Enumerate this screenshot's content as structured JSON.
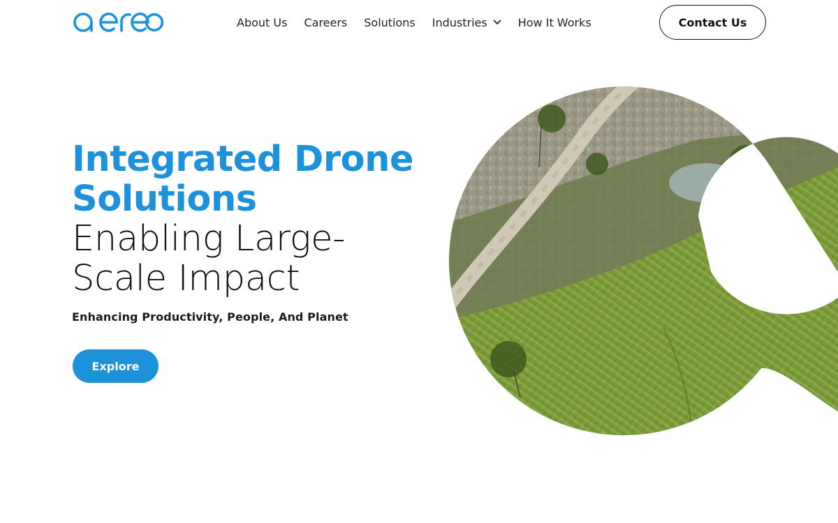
{
  "header": {
    "logo_text": "aereo",
    "nav": [
      {
        "label": "About Us"
      },
      {
        "label": "Careers"
      },
      {
        "label": "Solutions"
      },
      {
        "label": "Industries",
        "has_dropdown": true
      },
      {
        "label": "How It Works"
      }
    ],
    "contact_label": "Contact Us"
  },
  "hero": {
    "title_line1": "Integrated Drone",
    "title_line2": "Solutions",
    "title_line3": "Enabling Large-",
    "title_line4": "Scale Impact",
    "subtitle": "Enhancing Productivity, People, And Planet",
    "cta_label": "Explore",
    "image_icon": "aerial-farmland-letter-a-graphic"
  },
  "colors": {
    "brand_blue": "#1e91db",
    "text_dark": "#111111",
    "field_green": "#7a9a3c",
    "path_gray": "#b9b3a4"
  }
}
